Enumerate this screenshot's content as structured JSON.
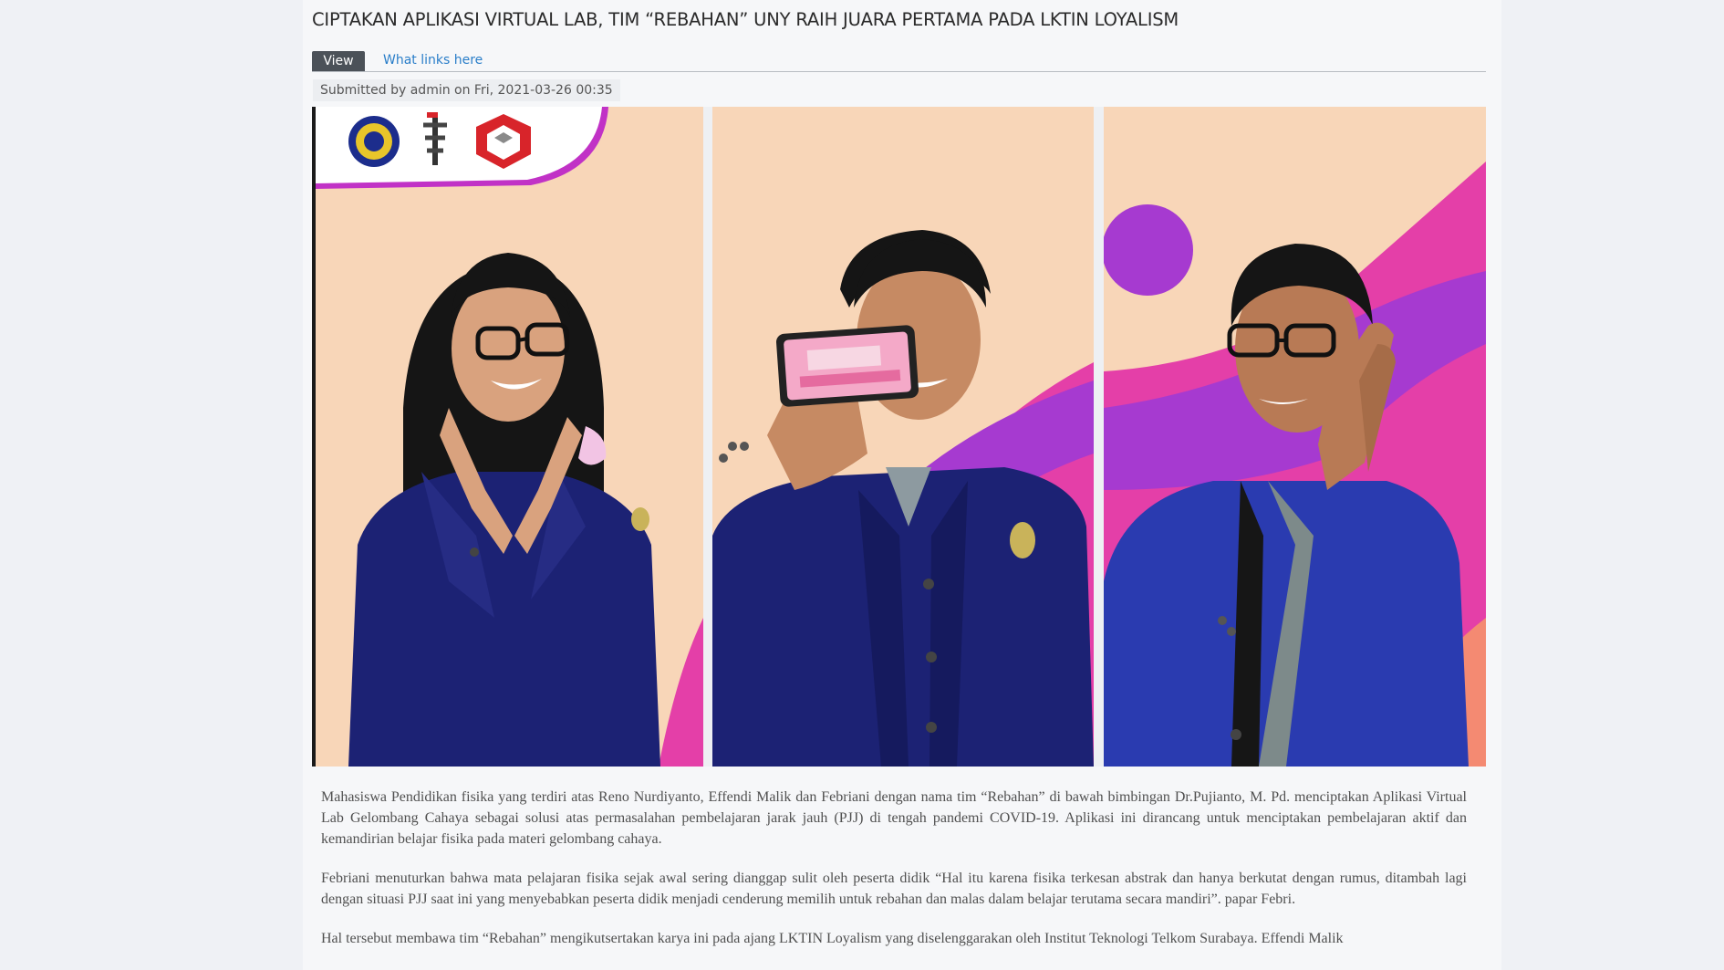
{
  "article": {
    "title": "CIPTAKAN APLIKASI VIRTUAL LAB, TIM “REBAHAN” UNY RAIH JUARA PERTAMA PADA LKTIN LOYALISM",
    "tabs": [
      {
        "label": "View",
        "active": true
      },
      {
        "label": "What links here",
        "active": false
      }
    ],
    "submitted": "Submitted by admin on Fri, 2021-03-26 00:35",
    "paragraphs": [
      "Mahasiswa Pendidikan fisika yang terdiri atas Reno Nurdiyanto, Effendi Malik dan Febriani dengan nama tim “Rebahan” di bawah bimbingan Dr.Pujianto, M. Pd. menciptakan Aplikasi Virtual Lab Gelombang Cahaya sebagai solusi atas permasalahan pembelajaran jarak jauh (PJJ) di tengah pandemi COVID-19. Aplikasi ini dirancang untuk menciptakan pembelajaran aktif dan kemandirian belajar fisika pada materi gelombang cahaya.",
      "Febriani menuturkan bahwa mata pelajaran fisika sejak awal sering dianggap sulit oleh peserta didik “Hal itu karena fisika terkesan abstrak dan hanya berkutat dengan rumus, ditambah lagi dengan situasi PJJ saat ini yang menyebabkan peserta didik menjadi cenderung memilih untuk rebahan dan malas dalam belajar terutama secara mandiri”. papar Febri.",
      "Hal tersebut  membawa tim “Rebahan” mengikutsertakan karya ini pada ajang LKTIN Loyalism yang diselenggarakan oleh Institut Teknologi Telkom Surabaya. Effendi Malik"
    ]
  },
  "colors": {
    "peach": "#f8d6b8",
    "magenta": "#e43fa8",
    "purple": "#a63ad0",
    "coral": "#f48a72",
    "jacket": "#1c2274",
    "jacket_bright": "#2a3bb0",
    "tab_dark": "#4b5158",
    "link": "#2a7ec9"
  }
}
